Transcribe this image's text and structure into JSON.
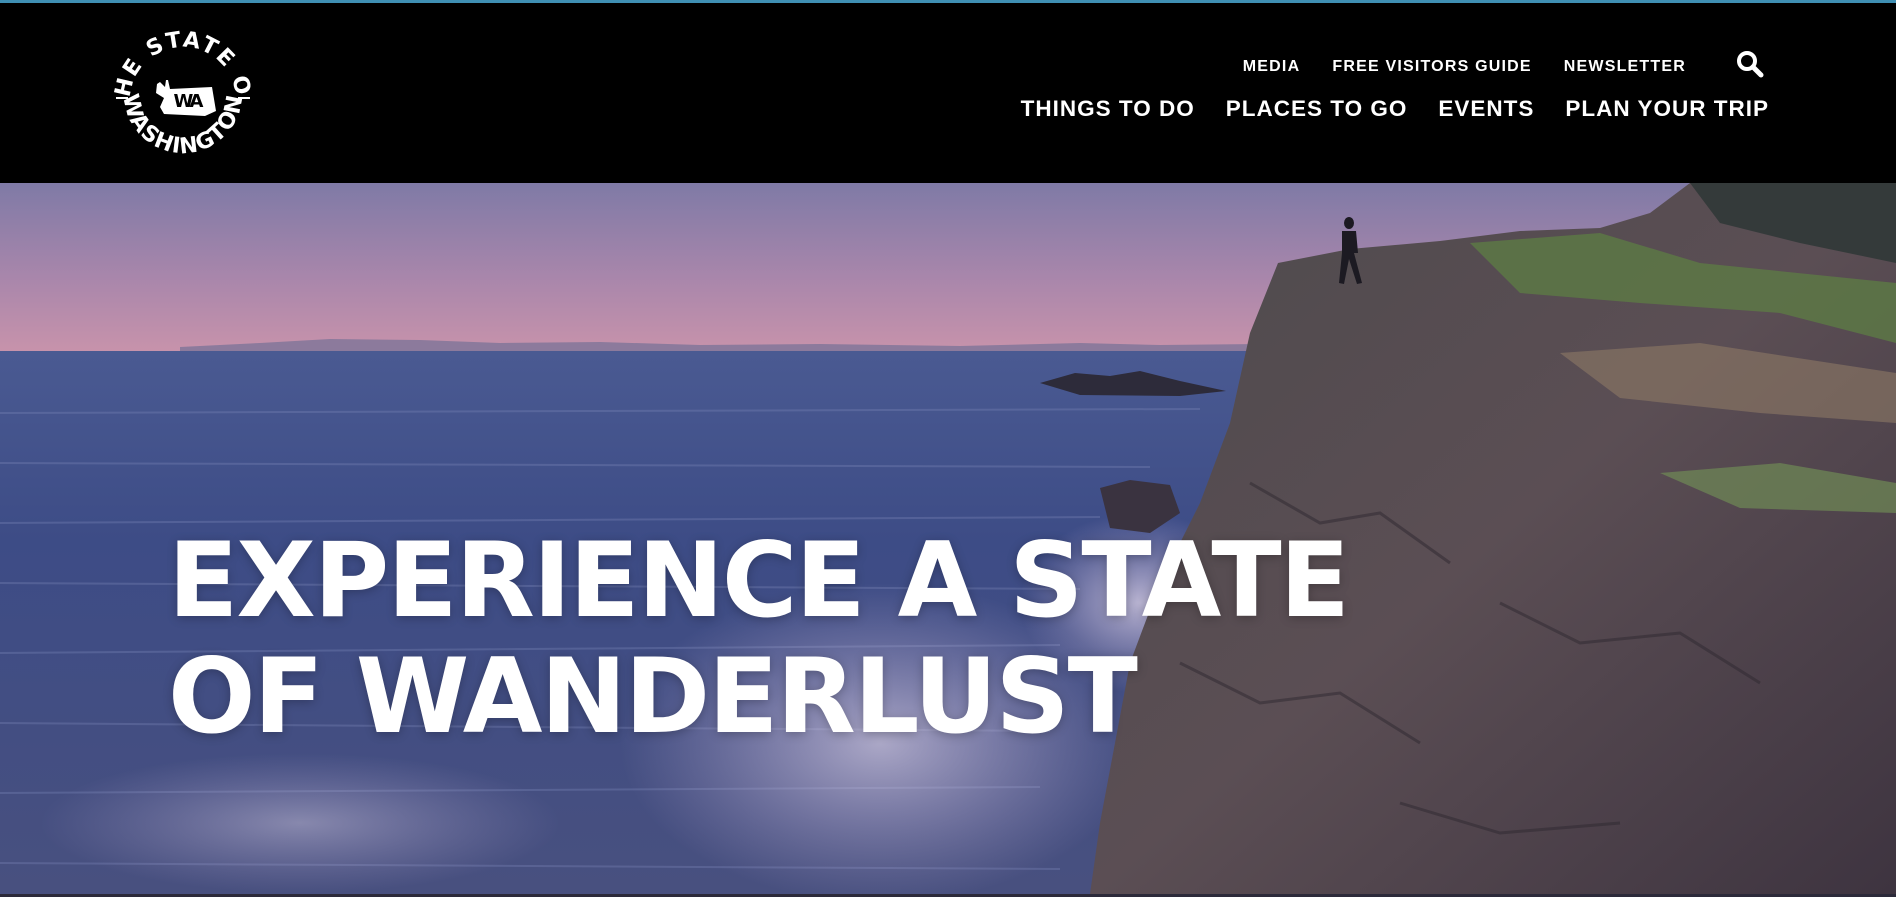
{
  "header": {
    "logo": {
      "top_text": "THE STATE OF",
      "bottom_text": "WASHINGTON",
      "badge": "WA"
    },
    "utility_links": [
      {
        "label": "MEDIA"
      },
      {
        "label": "FREE VISITORS GUIDE"
      },
      {
        "label": "NEWSLETTER"
      }
    ],
    "search_icon": "search-icon",
    "main_links": [
      {
        "label": "THINGS TO DO"
      },
      {
        "label": "PLACES TO GO"
      },
      {
        "label": "EVENTS"
      },
      {
        "label": "PLAN YOUR TRIP"
      }
    ]
  },
  "hero": {
    "headline_line1": "EXPERIENCE A STATE",
    "headline_line2": "OF WANDERLUST"
  },
  "colors": {
    "header_bg": "#000000",
    "accent": "#3f8fb3",
    "text": "#ffffff",
    "sky_top": "#8a7aa6",
    "sky_horizon": "#c48fa8",
    "ocean": "#3b4d86",
    "cliff": "#4b4049"
  }
}
